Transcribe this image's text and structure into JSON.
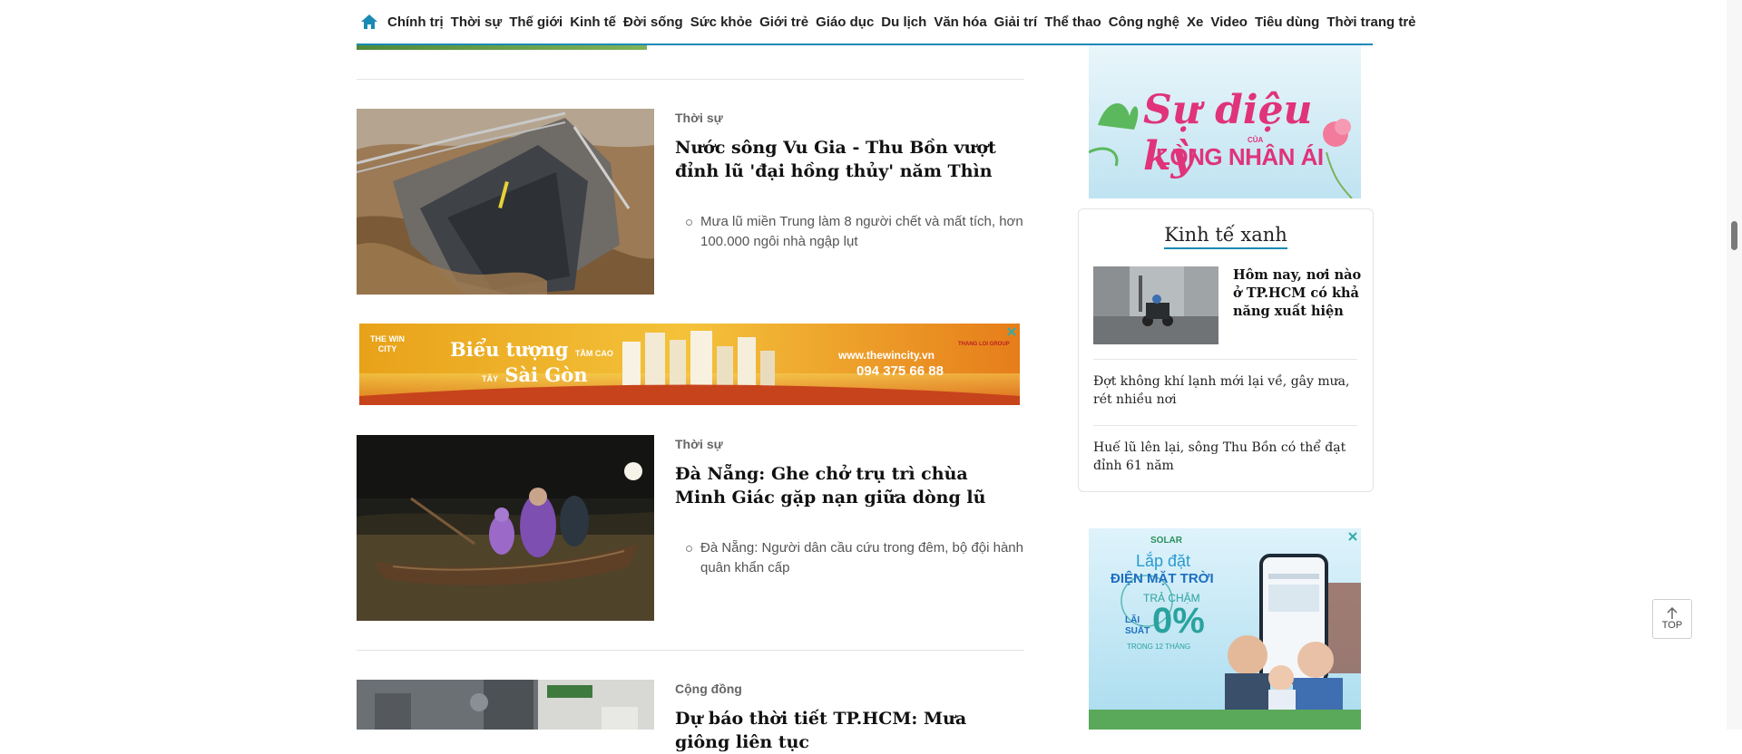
{
  "nav": {
    "items": [
      "Chính trị",
      "Thời sự",
      "Thế giới",
      "Kinh tế",
      "Đời sống",
      "Sức khỏe",
      "Giới trẻ",
      "Giáo dục",
      "Du lịch",
      "Văn hóa",
      "Giải trí",
      "Thể thao",
      "Công nghệ",
      "Xe",
      "Video",
      "Tiêu dùng",
      "Thời trang trẻ"
    ],
    "home_icon": "home-icon",
    "accent": "#1a8ab5"
  },
  "articles": [
    {
      "category": "Thời sự",
      "title": "Nước sông Vu Gia - Thu Bồn vượt đỉnh lũ 'đại hồng thủy' năm Thìn",
      "related": "Mưa lũ miền Trung làm 8 người chết và mất tích, hơn 100.000 ngôi nhà ngập lụt"
    },
    {
      "category": "Thời sự",
      "title": "Đà Nẵng: Ghe chở trụ trì chùa Minh Giác gặp nạn giữa dòng lũ",
      "related": "Đà Nẵng: Người dân cầu cứu trong đêm, bộ đội hành quân khẩn cấp"
    },
    {
      "category": "Cộng đồng",
      "title": "Dự báo thời tiết TP.HCM: Mưa giông liên tục"
    }
  ],
  "banner": {
    "brand": "THE WIN CITY",
    "line1": "Biểu tượng",
    "line1b": "TẦM CAO",
    "line2a": "TÂY",
    "line2": "Sài Gòn",
    "website": "www.thewincity.vn",
    "phone": "094 375 66 88",
    "group": "THANG LOI GROUP"
  },
  "ad_top": {
    "line1": "Sự diệu kỳ",
    "line_small": "CỦA",
    "line2": "LÒNG NHÂN ÁI"
  },
  "sidebar": {
    "section_title": "Kinh tế xanh",
    "featured_title": "Hôm nay, nơi nào ở TP.HCM có khả năng xuất hiện",
    "items": [
      "Đợt không khí lạnh mới lại về, gây mưa, rét nhiều nơi",
      "Huế lũ lên lại, sông Thu Bồn có thể đạt đỉnh 61 năm"
    ]
  },
  "ad_bottom": {
    "brand": "SOLAR",
    "line1": "Lắp đặt",
    "line2": "ĐIỆN MẶT TRỜI",
    "line3": "TRẢ CHẬM",
    "rate_label_a": "LÃI",
    "rate_label_b": "SUẤT",
    "rate": "0%",
    "term": "TRONG 12 THÁNG"
  },
  "to_top": {
    "label": "TOP"
  }
}
